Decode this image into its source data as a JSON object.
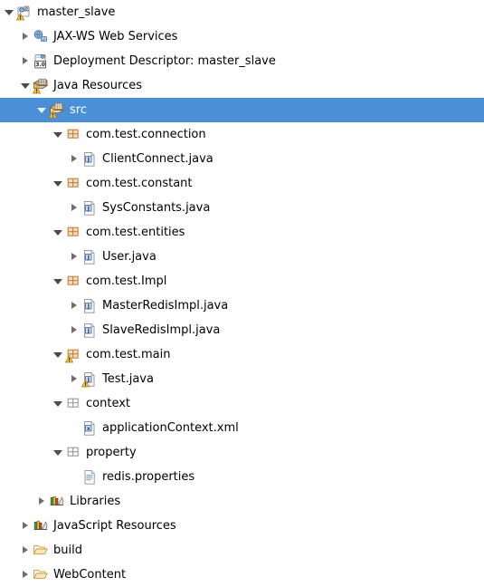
{
  "theme": {
    "selection_color": "#4a90d9",
    "selection_text_color": "#ffffff",
    "text_color": "#000000",
    "background": "#ffffff"
  },
  "tree": {
    "name": "project-explorer-tree",
    "nodes": [
      {
        "label": "master_slave",
        "icon": "java-web-project-icon",
        "state": "expanded",
        "indent": 0,
        "selected": false,
        "decorator": "warning"
      },
      {
        "label": "JAX-WS Web Services",
        "icon": "jax-ws-icon",
        "state": "collapsed",
        "indent": 1,
        "selected": false,
        "decorator": "none"
      },
      {
        "label": "Deployment Descriptor: master_slave",
        "icon": "deployment-descriptor-icon",
        "state": "collapsed",
        "indent": 1,
        "selected": false,
        "decorator": "none",
        "badge": "3.0"
      },
      {
        "label": "Java Resources",
        "icon": "java-resources-icon",
        "state": "expanded",
        "indent": 1,
        "selected": false,
        "decorator": "warning"
      },
      {
        "label": "src",
        "icon": "source-folder-icon",
        "state": "expanded",
        "indent": 2,
        "selected": true,
        "decorator": "warning"
      },
      {
        "label": "com.test.connection",
        "icon": "package-icon",
        "state": "expanded",
        "indent": 3,
        "selected": false,
        "decorator": "none"
      },
      {
        "label": "ClientConnect.java",
        "icon": "java-file-icon",
        "state": "collapsed",
        "indent": 4,
        "selected": false,
        "decorator": "none"
      },
      {
        "label": "com.test.constant",
        "icon": "package-icon",
        "state": "expanded",
        "indent": 3,
        "selected": false,
        "decorator": "none"
      },
      {
        "label": "SysConstants.java",
        "icon": "java-file-icon",
        "state": "collapsed",
        "indent": 4,
        "selected": false,
        "decorator": "none"
      },
      {
        "label": "com.test.entities",
        "icon": "package-icon",
        "state": "expanded",
        "indent": 3,
        "selected": false,
        "decorator": "none"
      },
      {
        "label": "User.java",
        "icon": "java-file-icon",
        "state": "collapsed",
        "indent": 4,
        "selected": false,
        "decorator": "none"
      },
      {
        "label": "com.test.Impl",
        "icon": "package-icon",
        "state": "expanded",
        "indent": 3,
        "selected": false,
        "decorator": "none"
      },
      {
        "label": "MasterRedisImpl.java",
        "icon": "java-file-icon",
        "state": "collapsed",
        "indent": 4,
        "selected": false,
        "decorator": "none"
      },
      {
        "label": "SlaveRedisImpl.java",
        "icon": "java-file-icon",
        "state": "collapsed",
        "indent": 4,
        "selected": false,
        "decorator": "none"
      },
      {
        "label": "com.test.main",
        "icon": "package-icon",
        "state": "expanded",
        "indent": 3,
        "selected": false,
        "decorator": "warning"
      },
      {
        "label": "Test.java",
        "icon": "java-file-icon",
        "state": "collapsed",
        "indent": 4,
        "selected": false,
        "decorator": "warning"
      },
      {
        "label": "context",
        "icon": "empty-package-icon",
        "state": "expanded",
        "indent": 3,
        "selected": false,
        "decorator": "none"
      },
      {
        "label": "applicationContext.xml",
        "icon": "xml-file-icon",
        "state": "leaf",
        "indent": 4,
        "selected": false,
        "decorator": "none"
      },
      {
        "label": "property",
        "icon": "empty-package-icon",
        "state": "expanded",
        "indent": 3,
        "selected": false,
        "decorator": "none"
      },
      {
        "label": "redis.properties",
        "icon": "properties-file-icon",
        "state": "leaf",
        "indent": 4,
        "selected": false,
        "decorator": "none"
      },
      {
        "label": "Libraries",
        "icon": "libraries-icon",
        "state": "collapsed",
        "indent": 2,
        "selected": false,
        "decorator": "none"
      },
      {
        "label": "JavaScript Resources",
        "icon": "libraries-icon",
        "state": "collapsed",
        "indent": 1,
        "selected": false,
        "decorator": "none"
      },
      {
        "label": "build",
        "icon": "folder-icon",
        "state": "collapsed",
        "indent": 1,
        "selected": false,
        "decorator": "none"
      },
      {
        "label": "WebContent",
        "icon": "folder-icon",
        "state": "collapsed",
        "indent": 1,
        "selected": false,
        "decorator": "none"
      }
    ]
  }
}
